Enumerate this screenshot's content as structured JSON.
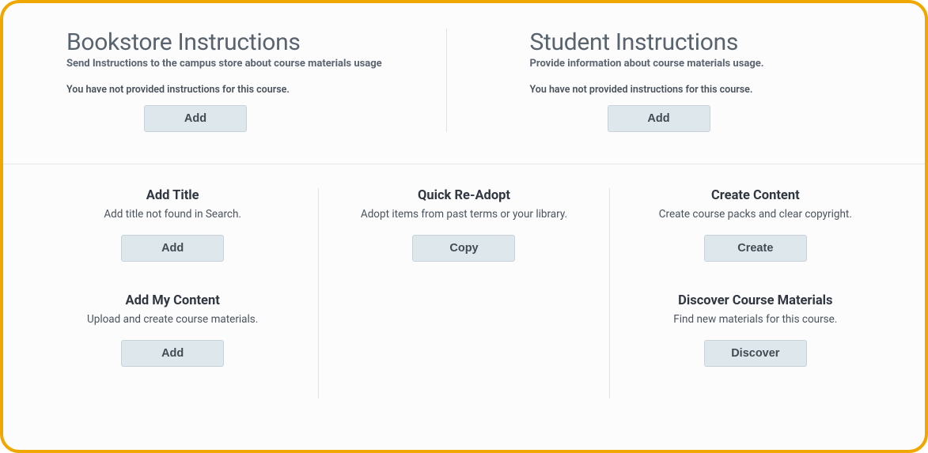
{
  "top": {
    "bookstore": {
      "title": "Bookstore Instructions",
      "subtitle": "Send Instructions to the campus store about course materials usage",
      "status": "You have not provided instructions for this course.",
      "button": "Add"
    },
    "student": {
      "title": "Student Instructions",
      "subtitle": "Provide information about course materials usage.",
      "status": "You have not provided instructions for this course.",
      "button": "Add"
    }
  },
  "cards": {
    "addTitle": {
      "title": "Add Title",
      "desc": "Add title not found in Search.",
      "button": "Add"
    },
    "quickReAdopt": {
      "title": "Quick Re-Adopt",
      "desc": "Adopt items from past terms or your library.",
      "button": "Copy"
    },
    "createContent": {
      "title": "Create Content",
      "desc": "Create course packs and clear copyright.",
      "button": "Create"
    },
    "addMyContent": {
      "title": "Add My Content",
      "desc": "Upload and create course materials.",
      "button": "Add"
    },
    "discover": {
      "title": "Discover Course Materials",
      "desc": "Find new materials for this course.",
      "button": "Discover"
    }
  }
}
